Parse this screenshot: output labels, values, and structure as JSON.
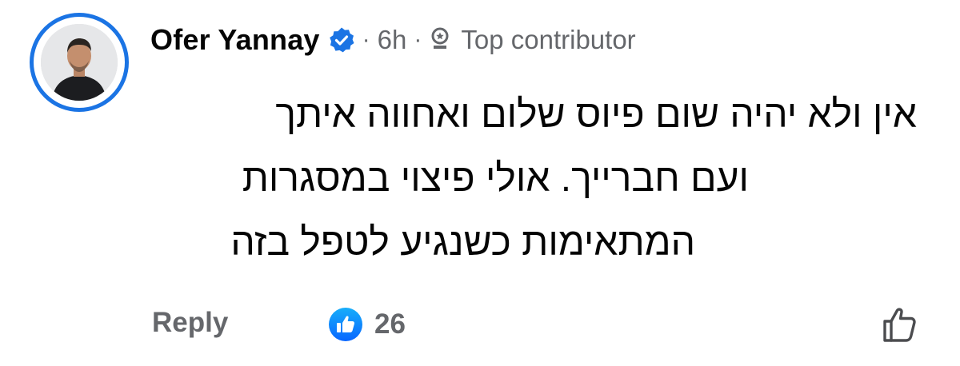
{
  "comment": {
    "author": {
      "name": "Ofer Yannay",
      "verified": true
    },
    "separator": "·",
    "time": "6h",
    "badge": {
      "label": "Top contributor",
      "icon": "top-contributor-badge-icon"
    },
    "text_lines": [
      "אין ולא יהיה שום פיוס שלום ואחווה איתך",
      "ועם חברייך. אולי פיצוי במסגרות",
      "המתאימות כשנגיע לטפל בזה"
    ],
    "actions": {
      "reply_label": "Reply",
      "reaction_count": "26",
      "reaction_icon": "like-reaction-icon",
      "like_icon": "thumbs-up-outline-icon"
    }
  },
  "colors": {
    "accent": "#1b74e4",
    "secondary_text": "#65676b",
    "primary_text": "#050505",
    "background": "#ffffff"
  }
}
